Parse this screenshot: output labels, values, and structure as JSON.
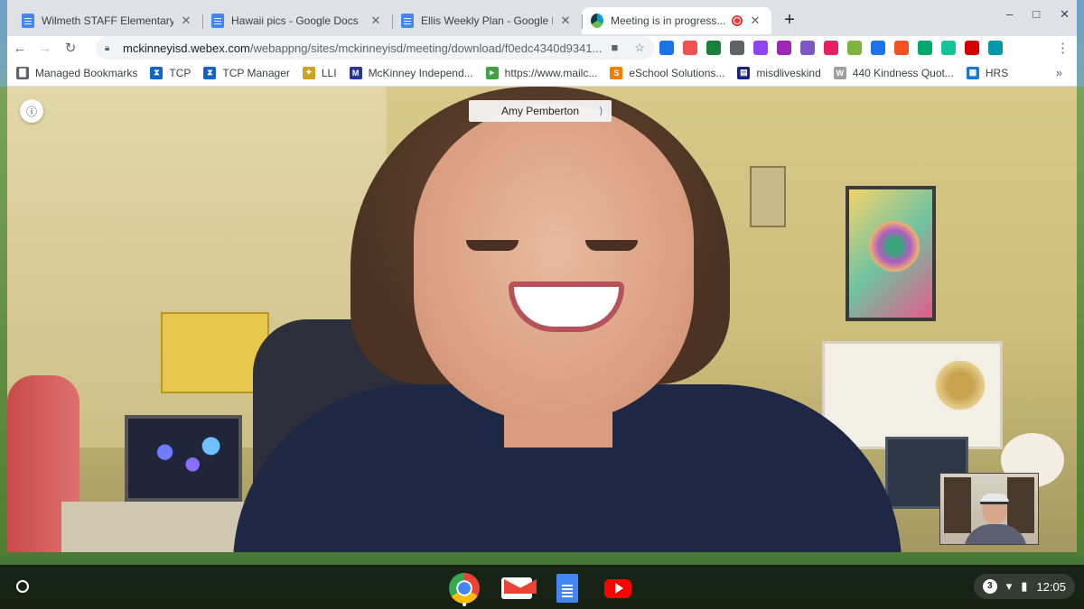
{
  "browser": {
    "tabs": [
      {
        "title": "Wilmeth STAFF Elementary One",
        "icon": "docs-icon",
        "active": false
      },
      {
        "title": "Hawaii pics - Google Docs",
        "icon": "docs-icon",
        "active": false
      },
      {
        "title": "Ellis Weekly Plan - Google Docs",
        "icon": "docs-icon",
        "active": false
      },
      {
        "title": "Meeting is in progress...",
        "icon": "webex-icon",
        "active": true,
        "recording": true
      }
    ],
    "new_tab": "+",
    "window_controls": {
      "minimize": "–",
      "maximize": "□",
      "close": "✕"
    },
    "nav": {
      "back": "←",
      "forward": "→",
      "reload": "↻"
    },
    "address": {
      "host": "mckinneyisd.webex.com",
      "path": "/webappng/sites/mckinneyisd/meeting/download/f0edc4340d9341..."
    },
    "extensions": [
      {
        "name": "ext-v-icon",
        "color": "#1a73e8"
      },
      {
        "name": "ext-screencast-icon",
        "color": "#ef5350"
      },
      {
        "name": "ext-green-plus-icon",
        "color": "#188038"
      },
      {
        "name": "ext-shield-icon",
        "color": "#5f6368"
      },
      {
        "name": "ext-purple-icon",
        "color": "#8e44ef"
      },
      {
        "name": "ext-puzzle-icon",
        "color": "#9c27b0"
      },
      {
        "name": "ext-pdf-icon",
        "color": "#7e57c2"
      },
      {
        "name": "ext-heart-icon",
        "color": "#e91e63"
      },
      {
        "name": "ext-star-icon",
        "color": "#7cb342"
      },
      {
        "name": "ext-dropper-icon",
        "color": "#1a73e8"
      },
      {
        "name": "ext-color-wheel-icon",
        "color": "#f4511e"
      },
      {
        "name": "ext-green-square-icon",
        "color": "#00a86b"
      },
      {
        "name": "ext-grammarly-icon",
        "color": "#15c39a"
      },
      {
        "name": "ext-red-square-icon",
        "color": "#d50000"
      },
      {
        "name": "ext-circle-icon",
        "color": "#0097a7"
      }
    ],
    "menu": "⋮"
  },
  "bookmarks": {
    "items": [
      {
        "label": "Managed Bookmarks",
        "icon": "folder-icon",
        "color": "#5f6368",
        "glyph": "▇"
      },
      {
        "label": "TCP",
        "icon": "tcp-icon",
        "color": "#1565c0",
        "glyph": "⧗"
      },
      {
        "label": "TCP Manager",
        "icon": "tcp-icon",
        "color": "#1565c0",
        "glyph": "⧗"
      },
      {
        "label": "LLI",
        "icon": "lli-icon",
        "color": "#c9a227",
        "glyph": "✦"
      },
      {
        "label": "McKinney Independ...",
        "icon": "m-icon",
        "color": "#283593",
        "glyph": "M"
      },
      {
        "label": "https://www.mailc...",
        "icon": "mailchimp-icon",
        "color": "#43a047",
        "glyph": "▸"
      },
      {
        "label": "eSchool Solutions...",
        "icon": "sfe-icon",
        "color": "#f57c00",
        "glyph": "S"
      },
      {
        "label": "misdliveskind",
        "icon": "site-icon",
        "color": "#1a237e",
        "glyph": "▤"
      },
      {
        "label": "440 Kindness Quot...",
        "icon": "w-icon",
        "color": "#9e9e9e",
        "glyph": "W"
      },
      {
        "label": "HRS",
        "icon": "calendar-icon",
        "color": "#1976d2",
        "glyph": "▦"
      }
    ],
    "more": "»"
  },
  "meeting": {
    "speaker_name": "Amy Pemberton",
    "info_symbol": "ⓘ",
    "speaking_symbol": ")"
  },
  "shelf": {
    "launcher": "launcher",
    "apps": [
      "chrome-app-icon",
      "gmail-app-icon",
      "docs-app-icon",
      "youtube-app-icon"
    ],
    "notification_count": "3",
    "wifi": "▾",
    "battery": "▮",
    "time": "12:05"
  }
}
